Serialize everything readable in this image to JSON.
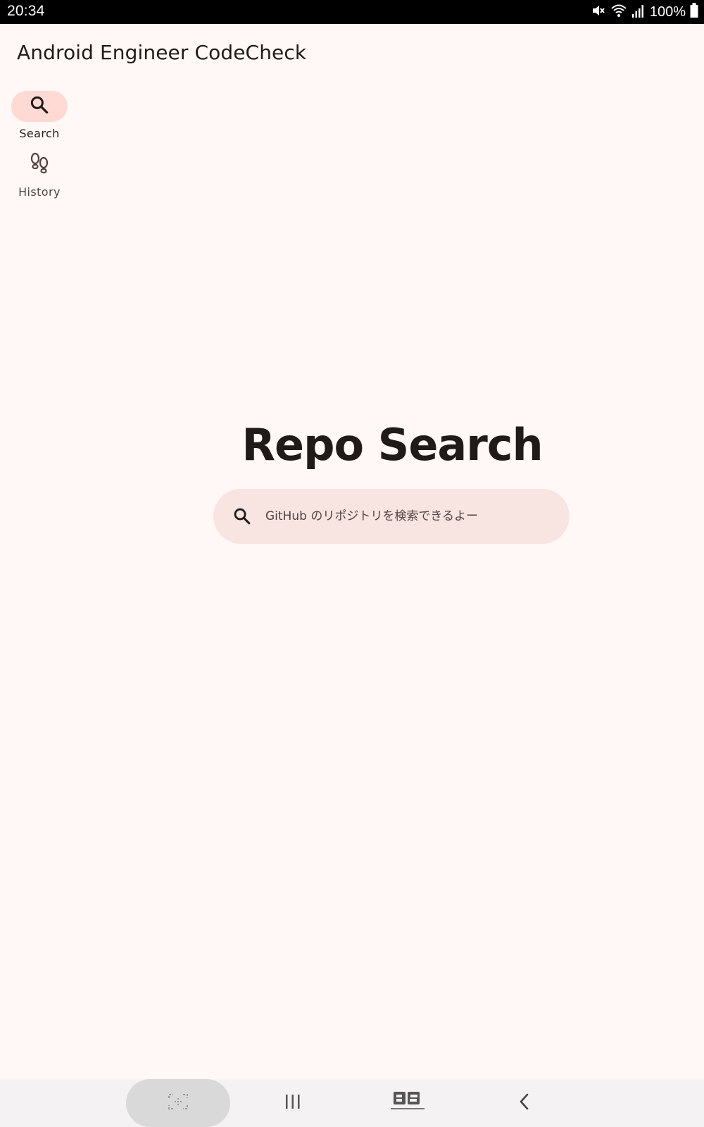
{
  "status_bar": {
    "time": "20:34",
    "battery": "100%",
    "icons": [
      "mute-icon",
      "wifi-icon",
      "signal-icon",
      "battery-icon"
    ]
  },
  "app_bar": {
    "title": "Android Engineer CodeCheck"
  },
  "navigation_rail": {
    "items": [
      {
        "label": "Search",
        "icon": "search-icon",
        "active": true
      },
      {
        "label": "History",
        "icon": "footprint-icon",
        "active": false
      }
    ]
  },
  "main": {
    "heading": "Repo Search",
    "search": {
      "placeholder": "GitHub のリポジトリを検索できるよー",
      "value": ""
    }
  },
  "system_nav": {
    "buttons": [
      "capture-icon",
      "recents-icon",
      "app-logo-icon",
      "back-icon"
    ]
  },
  "colors": {
    "background": "#fff8f6",
    "rail_active": "#ffdad4",
    "search_bar": "#f8e4e1",
    "text": "#201a19"
  }
}
